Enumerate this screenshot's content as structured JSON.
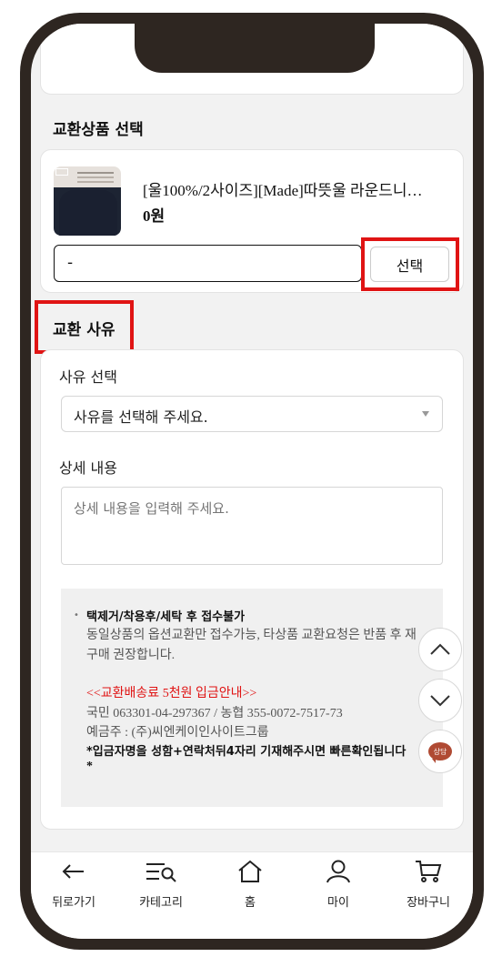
{
  "exchange_product": {
    "section_title": "교환상품 선택",
    "product_name": "[울100%/2사이즈][Made]따뜻울 라운드니…",
    "price": "0원",
    "option_value": "-",
    "select_button": "선택"
  },
  "exchange_reason": {
    "section_title": "교환 사유",
    "reason_label": "사유 선택",
    "reason_dropdown_value": "사유를 선택해 주세요.",
    "detail_label": "상세 내용",
    "detail_placeholder": "상세 내용을 입력해 주세요."
  },
  "notice": {
    "line1": "택제거/착용후/세탁 후 접수불가",
    "line2": "동일상품의 옵션교환만 접수가능, 타상품 교환요청은 반품 후 재",
    "line3": "구매 권장합니다.",
    "line4": "<<교환배송료 5천원 입금안내>>",
    "line5": "국민 063301-04-297367 / 농협 355-0072-7517-73",
    "line6": "예금주 : (주)씨엔케이인사이트그룹",
    "line7": "*입금자명을 성함+연락처뒤4자리 기재해주시면 빠른확인됩니다",
    "line8": "*"
  },
  "floating": {
    "chat_label": "상담"
  },
  "bottom_nav": {
    "back": "뒤로가기",
    "category": "카테고리",
    "home": "홈",
    "my": "마이",
    "cart": "장바구니"
  },
  "colors": {
    "highlight": "#e01414",
    "device_frame": "#2e2621",
    "chat_button": "#b04a33"
  }
}
